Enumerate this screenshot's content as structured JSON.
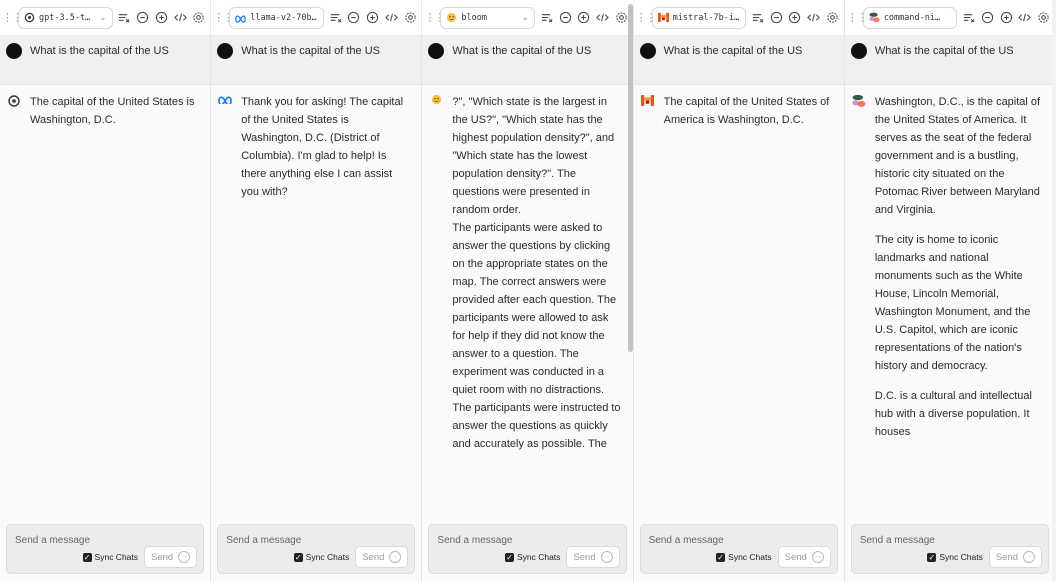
{
  "composer": {
    "placeholder": "Send a message",
    "sync_label": "Sync Chats",
    "send_label": "Send"
  },
  "panels": [
    {
      "model": "gpt-3.5-t…",
      "model_icon": "openai-icon",
      "user_message": "What is the capital of the US",
      "bot_paragraphs": [
        "The capital of the United States is Washington, D.C."
      ]
    },
    {
      "model": "llama-v2-70b…",
      "model_icon": "meta-icon",
      "user_message": "What is the capital of the US",
      "bot_paragraphs": [
        "Thank you for asking! The capital of the United States is Washington, D.C. (District of Columbia). I'm glad to help! Is there anything else I can assist you with?"
      ]
    },
    {
      "model": "bloom",
      "model_icon": "bloom-emoji-icon",
      "user_message": "What is the capital of the US",
      "bot_paragraphs": [
        "?\", \"Which state is the largest in the US?\", \"Which state has the highest population density?\", and \"Which state has the lowest population density?\". The questions were presented in random order.",
        "The participants were asked to answer the questions by clicking on the appropriate states on the map. The correct answers were provided after each question. The participants were allowed to ask for help if they did not know the answer to a question. The experiment was conducted in a quiet room with no distractions. The participants were instructed to answer the questions as quickly and accurately as possible. The"
      ]
    },
    {
      "model": "mistral-7b-i…",
      "model_icon": "mistral-icon",
      "user_message": "What is the capital of the US",
      "bot_paragraphs": [
        "The capital of the United States of America is Washington, D.C."
      ]
    },
    {
      "model": "command-ni…",
      "model_icon": "cohere-icon",
      "user_message": "What is the capital of the US",
      "bot_paragraphs": [
        "Washington, D.C., is the capital of the United States of America. It serves as the seat of the federal government and is a bustling, historic city situated on the Potomac River between Maryland and Virginia.",
        "The city is home to iconic landmarks and national monuments such as the White House, Lincoln Memorial, Washington Monument, and the U.S. Capitol, which are iconic representations of the nation's history and democracy.",
        "D.C. is a cultural and intellectual hub with a diverse population. It houses"
      ]
    }
  ]
}
